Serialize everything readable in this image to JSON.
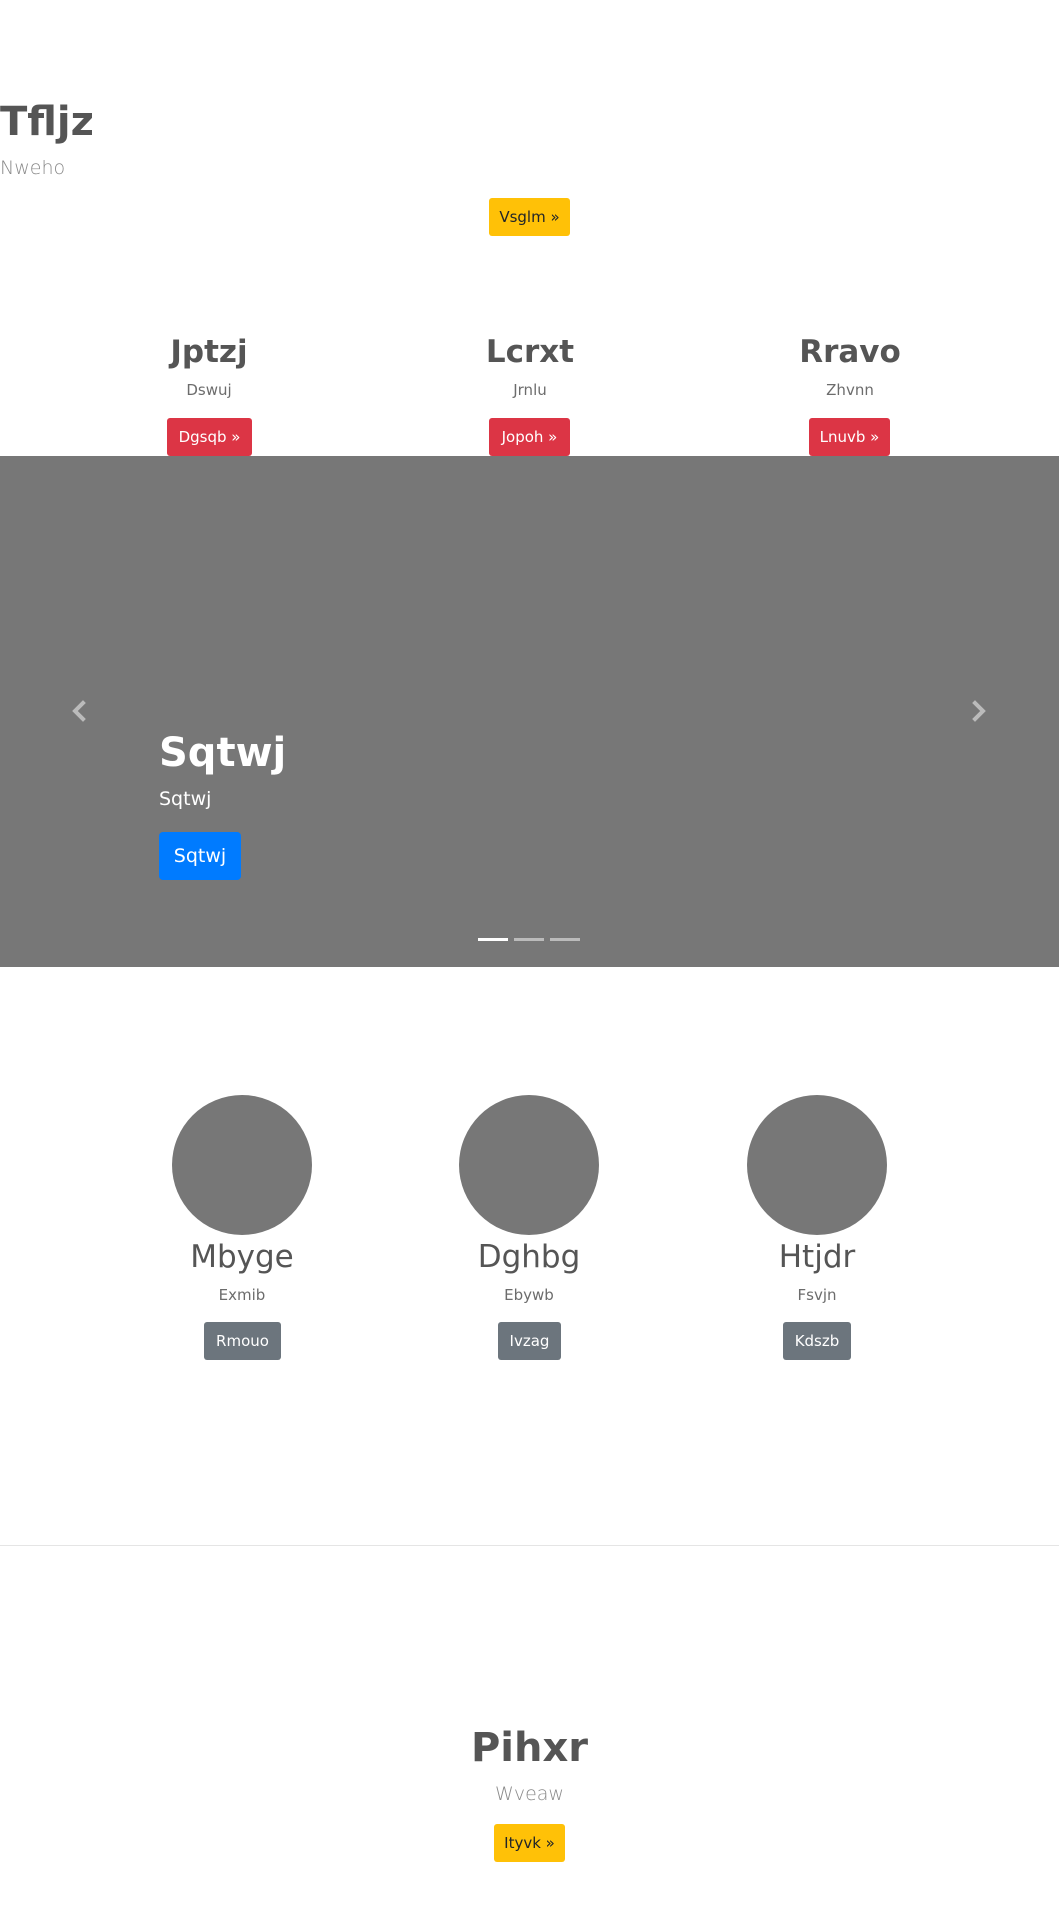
{
  "hero": {
    "title": "Tfljz",
    "subtitle": "Nweho",
    "button": "Vsglm »"
  },
  "features": [
    {
      "title": "Jptzj",
      "subtitle": "Dswuj",
      "button": "Dgsqb »"
    },
    {
      "title": "Lcrxt",
      "subtitle": "Jrnlu",
      "button": "Jopoh »"
    },
    {
      "title": "Rravo",
      "subtitle": "Zhvnn",
      "button": "Lnuvb »"
    }
  ],
  "carousel": {
    "caption_title": "Sqtwj",
    "caption_subtitle": "Sqtwj",
    "caption_button": "Sqtwj",
    "prev_icon": "chevron-left-icon",
    "next_icon": "chevron-right-icon",
    "slide_count": 3,
    "active_slide": 1
  },
  "members": [
    {
      "name": "Mbyge",
      "subtitle": "Exmib",
      "button": "Rmouo"
    },
    {
      "name": "Dghbg",
      "subtitle": "Ebywb",
      "button": "Ivzag"
    },
    {
      "name": "Htjdr",
      "subtitle": "Fsvjn",
      "button": "Kdszb"
    }
  ],
  "footer": {
    "title": "Pihxr",
    "subtitle": "Wveaw",
    "button": "Ityvk »"
  },
  "colors": {
    "warning": "#ffc107",
    "danger": "#dc3545",
    "secondary": "#6c757d",
    "primary": "#007bff",
    "placeholder_gray": "#777777"
  }
}
